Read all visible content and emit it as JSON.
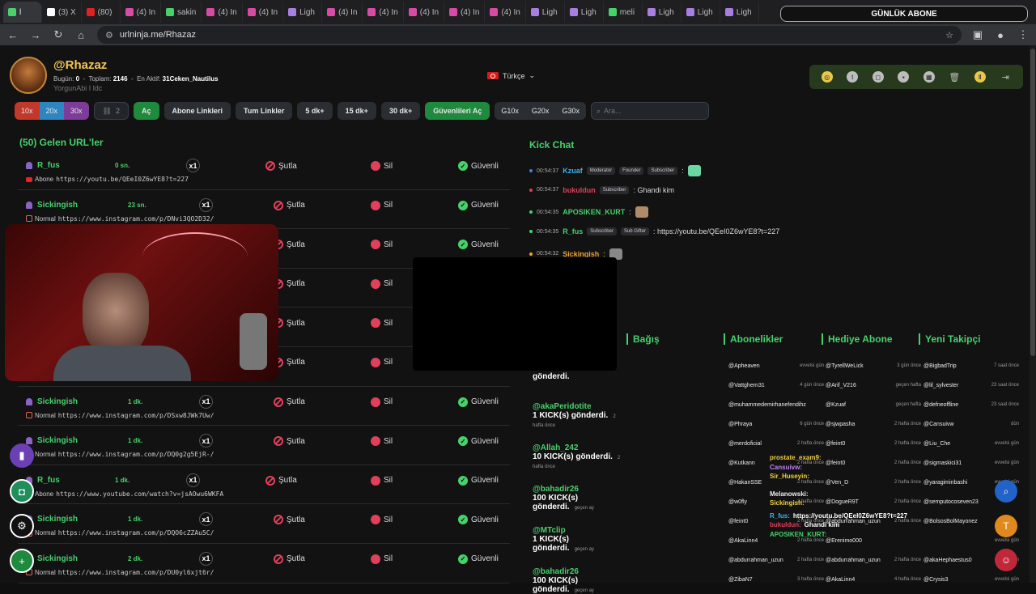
{
  "browser": {
    "tabs": [
      {
        "label": "l",
        "color": "#46d16b",
        "active": true
      },
      {
        "label": "(3) X",
        "color": "#ffffff"
      },
      {
        "label": "(80)",
        "color": "#e22222"
      },
      {
        "label": "(4) In",
        "color": "#d64ba3"
      },
      {
        "label": "sakin",
        "color": "#46d16b"
      },
      {
        "label": "(4) In",
        "color": "#d64ba3"
      },
      {
        "label": "(4) In",
        "color": "#d64ba3"
      },
      {
        "label": "Ligh",
        "color": "#a77fe0"
      },
      {
        "label": "(4) In",
        "color": "#d64ba3"
      },
      {
        "label": "(4) In",
        "color": "#d64ba3"
      },
      {
        "label": "(4) In",
        "color": "#d64ba3"
      },
      {
        "label": "(4) In",
        "color": "#d64ba3"
      },
      {
        "label": "(4) In",
        "color": "#d64ba3"
      },
      {
        "label": "Ligh",
        "color": "#a77fe0"
      },
      {
        "label": "Ligh",
        "color": "#a77fe0"
      },
      {
        "label": "meli",
        "color": "#46d16b"
      },
      {
        "label": "Ligh",
        "color": "#a77fe0"
      },
      {
        "label": "Ligh",
        "color": "#a77fe0"
      },
      {
        "label": "Ligh",
        "color": "#a77fe0"
      }
    ],
    "url": "urlninja.me/Rhazaz",
    "overlay_title": "GÜNLÜK ABONE"
  },
  "profile": {
    "username": "@Rhazaz",
    "today_label": "Bugün:",
    "today_value": "0",
    "total_label": "Toplam:",
    "total_value": "2146",
    "most_active_label": "En Aktif:",
    "most_active_value": "31Ceken_Nautilus",
    "subtitle": "YorgunAbi I ldc",
    "language": "Türkçe"
  },
  "toolbar": {
    "speed": [
      "10x",
      "20x",
      "30x"
    ],
    "link_count": "2",
    "open": "Aç",
    "sub_links": "Abone Linkleri",
    "all_links": "Tum Linkler",
    "min5": "5 dk+",
    "min15": "15 dk+",
    "min30": "30 dk+",
    "safe_open": "Güvenlileri Aç",
    "g": [
      "G10x",
      "G20x",
      "G30x"
    ],
    "search_placeholder": "Ara..."
  },
  "list": {
    "title": "(50) Gelen URL'ler",
    "actions": {
      "kick": "Şutla",
      "delete": "Sil",
      "safe": "Güvenli"
    },
    "rows": [
      {
        "user": "R_fus",
        "time": "0 sn.",
        "count": "x1",
        "type": "Abone",
        "url": "https://youtu.be/QEeI0Z6wYE8?t=227",
        "src": "yt"
      },
      {
        "user": "Sickingish",
        "time": "23 sn.",
        "count": "x1",
        "type": "Normal",
        "url": "https://www.instagram.com/p/DNvi3QO2D32/",
        "src": "ig"
      },
      {
        "user": "",
        "time": "",
        "count": "",
        "type": "",
        "url": "",
        "src": ""
      },
      {
        "user": "",
        "time": "",
        "count": "",
        "type": "",
        "url": "",
        "src": ""
      },
      {
        "user": "",
        "time": "",
        "count": "",
        "type": "",
        "url": "",
        "src": ""
      },
      {
        "user": "",
        "time": "",
        "count": "",
        "type": "",
        "url": "",
        "src": ""
      },
      {
        "user": "Sickingish",
        "time": "1 dk.",
        "count": "x1",
        "type": "Normal",
        "url": "https://www.instagram.com/p/DSxw8JWk7Uw/",
        "src": "ig"
      },
      {
        "user": "Sickingish",
        "time": "1 dk.",
        "count": "x1",
        "type": "Normal",
        "url": "https://www.instagram.com/p/DQ0g2g5EjR-/",
        "src": "ig"
      },
      {
        "user": "R_fus",
        "time": "1 dk.",
        "count": "x1",
        "type": "Abone",
        "url": "https://www.youtube.com/watch?v=jsAOwu6WKFA",
        "src": "yt"
      },
      {
        "user": "Sickingish",
        "time": "1 dk.",
        "count": "x1",
        "type": "Normal",
        "url": "https://www.instagram.com/p/DQO6cZZAu5C/",
        "src": "ig"
      },
      {
        "user": "Sickingish",
        "time": "2 dk.",
        "count": "x1",
        "type": "Normal",
        "url": "https://www.instagram.com/p/DU0yl6xjt6r/",
        "src": "ig"
      }
    ]
  },
  "chat": {
    "title": "Kick Chat",
    "messages": [
      {
        "time": "00:54:37",
        "user": "Kzuaf",
        "color": "#3fb3f0",
        "dot": "#3f7fe0",
        "badges": [
          "Moderator",
          "Founder",
          "Subscriber"
        ],
        "text": ":"
      },
      {
        "time": "00:54:37",
        "user": "bukuldun",
        "color": "#e0405a",
        "dot": "#e0405a",
        "badges": [
          "Subscriber"
        ],
        "text": ": Ghandi kim"
      },
      {
        "time": "00:54:35",
        "user": "APOSIKEN_KURT",
        "color": "#46d16b",
        "dot": "#46d16b",
        "badges": [],
        "text": ":"
      },
      {
        "time": "00:54:35",
        "user": "R_fus",
        "color": "#46d16b",
        "dot": "#46d16b",
        "badges": [
          "Subscriber",
          "Sub Gifter"
        ],
        "text": ": https://youtu.be/QEeI0Z6wYE8?t=227"
      },
      {
        "time": "00:54:32",
        "user": "Sickingish",
        "color": "#f0a030",
        "dot": "#f0a030",
        "badges": [],
        "text": ":"
      }
    ]
  },
  "kicks": [
    {
      "user": "",
      "text": "gönderdi.",
      "when": ""
    },
    {
      "user": "@akaPeridotite",
      "text": "1 KICK(s) gönderdi.",
      "when": "2 hafta önce"
    },
    {
      "user": "@Allah_242",
      "text": "10 KICK(s) gönderdi.",
      "when": "2 hafta önce"
    },
    {
      "user": "@bahadir26",
      "text": "100 KICK(s) gönderdi.",
      "when": "geçen ay"
    },
    {
      "user": "@MTclip",
      "text": "1 KICK(s) gönderdi.",
      "when": "geçen ay"
    },
    {
      "user": "@bahadir26",
      "text": "100 KICK(s) gönderdi.",
      "when": "geçen ay"
    }
  ],
  "columns": {
    "donation": "Bağış",
    "subs": {
      "title": "Abonelikler",
      "items": [
        {
          "u": "@Apheaven",
          "w": "evvelsi gün"
        },
        {
          "u": "@Vattghern31",
          "w": "4 gün önce"
        },
        {
          "u": "@muhammedemirhanefendihz",
          "w": ""
        },
        {
          "u": "@Phraya",
          "w": "6 gün önce"
        },
        {
          "u": "@merdoficial",
          "w": "2 hafta önce"
        },
        {
          "u": "@Kutkann",
          "w": "2 hafta önce"
        },
        {
          "u": "@HakanSSE",
          "w": "2 hafta önce"
        },
        {
          "u": "@w0fly",
          "w": "2 hafta önce"
        },
        {
          "u": "@feint0",
          "w": "2 hafta önce"
        },
        {
          "u": "@AkaLinn4",
          "w": "2 hafta önce"
        },
        {
          "u": "@abdurrahman_uzun",
          "w": "2 hafta önce"
        },
        {
          "u": "@ZibaN7",
          "w": "3 hafta önce"
        }
      ]
    },
    "gifts": {
      "title": "Hediye Abone",
      "items": [
        {
          "u": "@TyrellWeLick",
          "w": "3 gün önce"
        },
        {
          "u": "@Arif_V216",
          "w": "geçen hafta"
        },
        {
          "u": "@Kzuaf",
          "w": "geçen hafta"
        },
        {
          "u": "@sjwpasha",
          "w": "2 hafta önce"
        },
        {
          "u": "@feint0",
          "w": "2 hafta önce"
        },
        {
          "u": "@feint0",
          "w": "2 hafta önce"
        },
        {
          "u": "@Ven_D",
          "w": "2 hafta önce"
        },
        {
          "u": "@DogueR9T",
          "w": "2 hafta önce"
        },
        {
          "u": "@abdurrahman_uzun",
          "w": "2 hafta önce"
        },
        {
          "u": "@Erenimo000",
          "w": ""
        },
        {
          "u": "@abdurrahman_uzun",
          "w": "2 hafta önce"
        },
        {
          "u": "@AkaLinn4",
          "w": "4 hafta önce"
        }
      ]
    },
    "follows": {
      "title": "Yeni Takipçi",
      "items": [
        {
          "u": "@BigbadTrip",
          "w": "7 saat önce"
        },
        {
          "u": "@lil_sylvester",
          "w": "23 saat önce"
        },
        {
          "u": "@defneoffline",
          "w": "23 saat önce"
        },
        {
          "u": "@Cansuivw",
          "w": "dün"
        },
        {
          "u": "@Liu_Che",
          "w": "evvelsi gün"
        },
        {
          "u": "@sigmaskici31",
          "w": "evvelsi gün"
        },
        {
          "u": "@yaragiminbashi",
          "w": "evvelsi gün"
        },
        {
          "u": "@semputocoseven23",
          "w": ""
        },
        {
          "u": "@BolsosBolMayonez",
          "w": ""
        },
        {
          "u": "",
          "w": "evvelsi gün"
        },
        {
          "u": "@akaHephaestus0",
          "w": "evvelsi gün"
        },
        {
          "u": "@Crysis3",
          "w": "evvelsi gün"
        }
      ]
    }
  },
  "overlay_chat": [
    {
      "u": "prostate_exam9:",
      "t": ""
    },
    {
      "u": "Cansuivw:",
      "t": ""
    },
    {
      "u": "Sir_Huseyin:",
      "t": ""
    },
    {
      "u": "Melanowski:",
      "t": ""
    },
    {
      "u": "Sickingish:",
      "t": ""
    },
    {
      "u": "R_fus:",
      "t": "https://youtu.be/QEeI0Z6wYE8?t=227"
    },
    {
      "u": "bukuldun:",
      "t": "Ghandi kim"
    },
    {
      "u": "APOSIKEN_KURT:",
      "t": ""
    }
  ],
  "colors": {
    "accent": "#46d16b",
    "danger": "#e0405a",
    "username": "#f3c653",
    "bg": "#121212"
  }
}
